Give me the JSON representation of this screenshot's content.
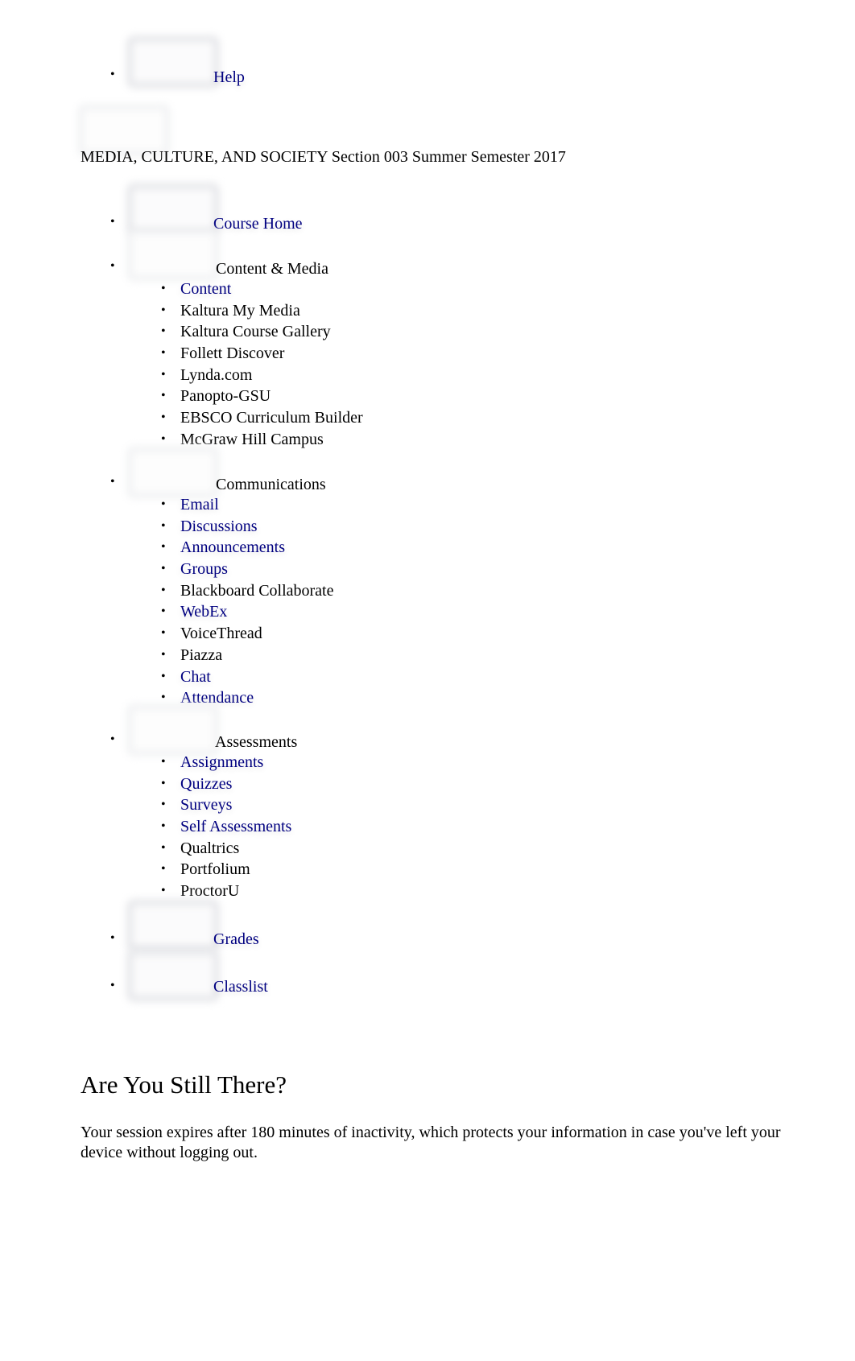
{
  "top_nav": {
    "help_label": "Help"
  },
  "course": {
    "title": "MEDIA, CULTURE, AND SOCIETY Section 003 Summer Semester 2017"
  },
  "nav": {
    "course_home": "Course Home",
    "content_media": {
      "label": "Content & Media",
      "items": [
        {
          "label": "Content",
          "link": true
        },
        {
          "label": "Kaltura My Media",
          "link": false
        },
        {
          "label": "Kaltura Course Gallery",
          "link": false
        },
        {
          "label": "Follett Discover",
          "link": false
        },
        {
          "label": "Lynda.com",
          "link": false
        },
        {
          "label": "Panopto-GSU",
          "link": false
        },
        {
          "label": "EBSCO Curriculum Builder",
          "link": false
        },
        {
          "label": "McGraw Hill Campus",
          "link": false
        }
      ]
    },
    "communications": {
      "label": "Communications",
      "items": [
        {
          "label": "Email",
          "link": true
        },
        {
          "label": "Discussions",
          "link": true
        },
        {
          "label": "Announcements",
          "link": true
        },
        {
          "label": "Groups",
          "link": true
        },
        {
          "label": "Blackboard Collaborate",
          "link": false
        },
        {
          "label": "WebEx",
          "link": true
        },
        {
          "label": "VoiceThread",
          "link": false
        },
        {
          "label": "Piazza",
          "link": false
        },
        {
          "label": "Chat",
          "link": true
        },
        {
          "label": "Attendance",
          "link": true
        }
      ]
    },
    "assessments": {
      "label": "Assessments",
      "items": [
        {
          "label": "Assignments",
          "link": true
        },
        {
          "label": "Quizzes",
          "link": true
        },
        {
          "label": "Surveys",
          "link": true
        },
        {
          "label": "Self Assessments",
          "link": true
        },
        {
          "label": "Qualtrics",
          "link": false
        },
        {
          "label": "Portfolium",
          "link": false
        },
        {
          "label": "ProctorU",
          "link": false
        }
      ]
    },
    "grades": "Grades",
    "classlist": "Classlist"
  },
  "session_dialog": {
    "title": "Are You Still There?",
    "body": "Your session expires after 180 minutes of inactivity, which protects your information in case you've left your device without logging out."
  },
  "colors": {
    "link": "#000080",
    "text": "#000000",
    "placeholder_border": "#dfe0e4"
  }
}
